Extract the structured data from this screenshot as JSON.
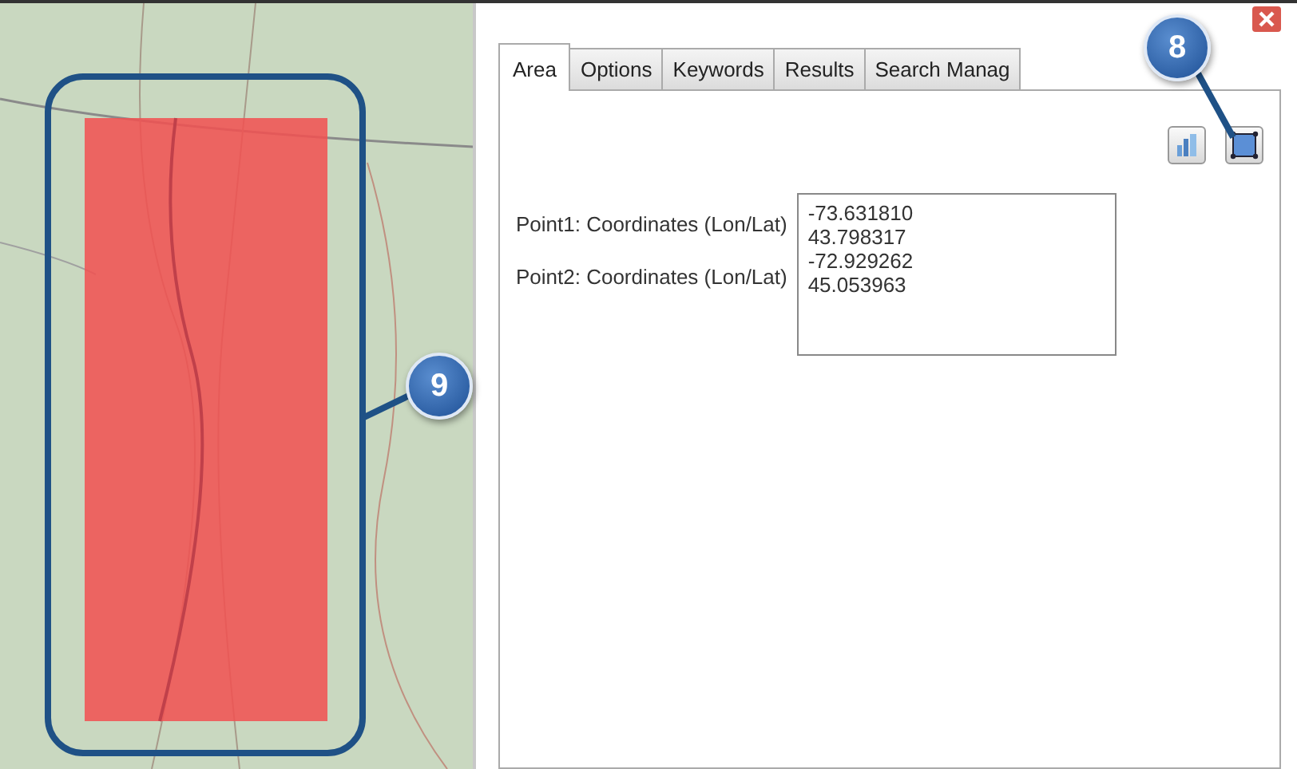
{
  "tabs": [
    {
      "label": "Area",
      "selected": true
    },
    {
      "label": "Options",
      "selected": false
    },
    {
      "label": "Keywords",
      "selected": false
    },
    {
      "label": "Results",
      "selected": false
    },
    {
      "label": "Search Manag",
      "selected": false
    }
  ],
  "area": {
    "point_labels": [
      "Point1: Coordinates (Lon/Lat)",
      "Point2: Coordinates (Lon/Lat)"
    ],
    "coordinates_field": {
      "value": "-73.631810\n43.798317\n-72.929262\n45.053963"
    }
  },
  "callouts": [
    {
      "label": "8"
    },
    {
      "label": "9"
    }
  ]
}
